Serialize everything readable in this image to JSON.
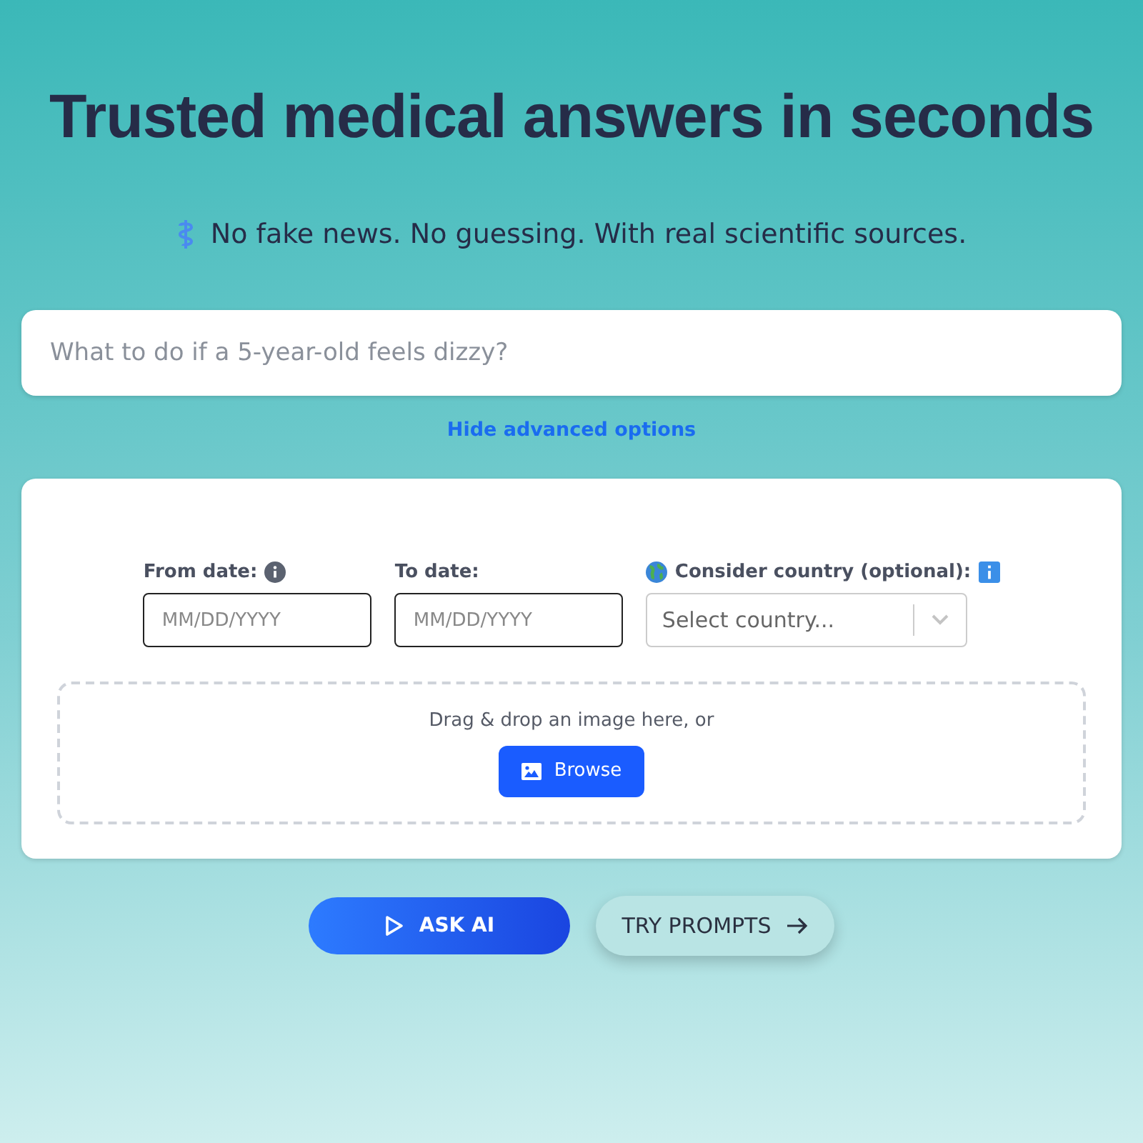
{
  "title": "Trusted medical answers in seconds",
  "subtitle": "No fake news. No guessing. With real scientific sources.",
  "search": {
    "placeholder": "What to do if a 5-year-old feels dizzy?"
  },
  "advanced_toggle": "Hide advanced options",
  "advanced": {
    "from_date": {
      "label": "From date:",
      "placeholder": "MM/DD/YYYY"
    },
    "to_date": {
      "label": "To date:",
      "placeholder": "MM/DD/YYYY"
    },
    "country": {
      "label": "Consider country (optional):",
      "placeholder": "Select country..."
    },
    "upload": {
      "text": "Drag & drop an image here, or",
      "button": "Browse"
    }
  },
  "actions": {
    "ask": "ASK AI",
    "try": "TRY PROMPTS"
  }
}
